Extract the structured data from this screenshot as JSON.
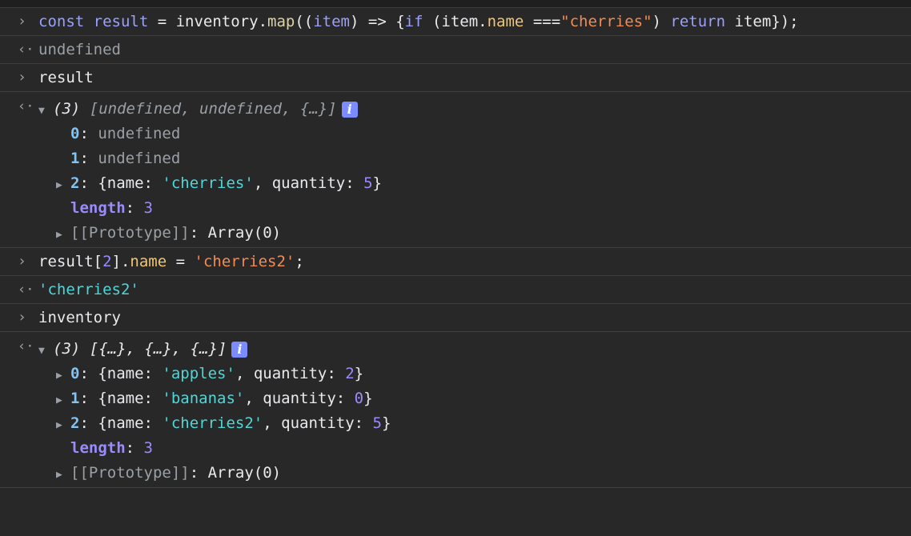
{
  "prefix": {
    "input": "›",
    "output": "‹·",
    "expand": "▼",
    "collapsed": "▶",
    "info": "i"
  },
  "entries": {
    "e1": {
      "t1": "const ",
      "t2": "result",
      "t3": " = ",
      "t4": "inventory",
      "t5": ".",
      "t6": "map",
      "t7": "((",
      "t8": "item",
      "t9": ") => {",
      "t10": "if",
      "t11": " (item.",
      "t12": "name",
      "t13": " ===",
      "t14": "\"cherries\"",
      "t15": ") ",
      "t16": "return",
      "t17": " item});"
    },
    "o1": {
      "text": "undefined"
    },
    "e2": {
      "text": "result"
    },
    "o2": {
      "count": "(3)",
      "summary": "[undefined, undefined, {…}]",
      "items": [
        {
          "key": "0",
          "colon": ": ",
          "value": "undefined"
        },
        {
          "key": "1",
          "colon": ": ",
          "value": "undefined"
        }
      ],
      "item2": {
        "key": "2",
        "colon": ": ",
        "open": "{name: ",
        "name": "'cherries'",
        "mid": ", quantity: ",
        "qty": "5",
        "close": "}"
      },
      "length_key": "length",
      "length_colon": ": ",
      "length_val": "3",
      "proto_key": "[[Prototype]]",
      "proto_colon": ": ",
      "proto_val": "Array(0)"
    },
    "e3": {
      "t1": "result[",
      "t2": "2",
      "t3": "].",
      "t4": "name",
      "t5": " = ",
      "t6": "'cherries2'",
      "t7": ";"
    },
    "o3": {
      "text": "'cherries2'"
    },
    "e4": {
      "text": "inventory"
    },
    "o4": {
      "count": "(3)",
      "summary": "[{…}, {…}, {…}]",
      "items": [
        {
          "key": "0",
          "colon": ": ",
          "open": "{name: ",
          "name": "'apples'",
          "mid": ", quantity: ",
          "qty": "2",
          "close": "}"
        },
        {
          "key": "1",
          "colon": ": ",
          "open": "{name: ",
          "name": "'bananas'",
          "mid": ", quantity: ",
          "qty": "0",
          "close": "}"
        },
        {
          "key": "2",
          "colon": ": ",
          "open": "{name: ",
          "name": "'cherries2'",
          "mid": ", quantity: ",
          "qty": "5",
          "close": "}"
        }
      ],
      "length_key": "length",
      "length_colon": ": ",
      "length_val": "3",
      "proto_key": "[[Prototype]]",
      "proto_colon": ": ",
      "proto_val": "Array(0)"
    }
  }
}
